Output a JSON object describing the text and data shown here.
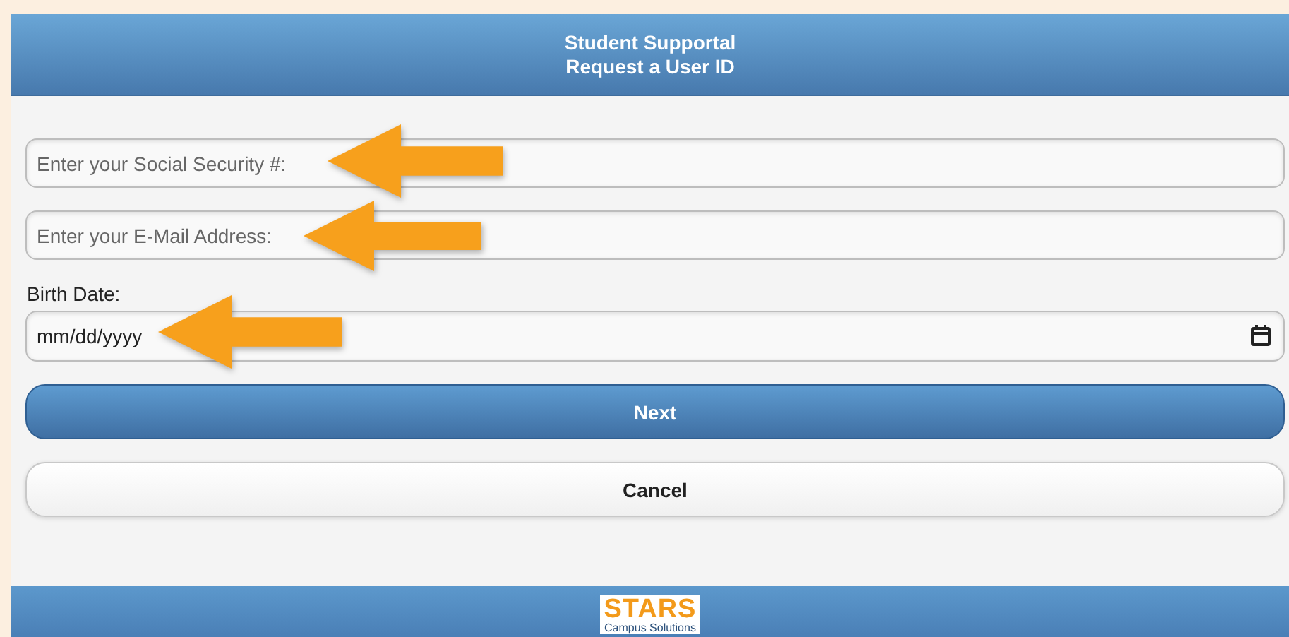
{
  "header": {
    "title": "Student Supportal",
    "subtitle": "Request a User ID"
  },
  "fields": [
    {
      "kind": "text",
      "placeholder": "Enter your Social Security #:"
    },
    {
      "kind": "text",
      "placeholder": "Enter your E-Mail Address:"
    },
    {
      "kind": "date",
      "label": "Birth Date:",
      "placeholder": "mm/dd/yyyy"
    }
  ],
  "buttons": [
    {
      "label": "Next",
      "kind": "primary"
    },
    {
      "label": "Cancel",
      "kind": "secondary"
    }
  ],
  "footer": {
    "logo": {
      "name": "STARS",
      "tagline": "Campus Solutions"
    }
  }
}
